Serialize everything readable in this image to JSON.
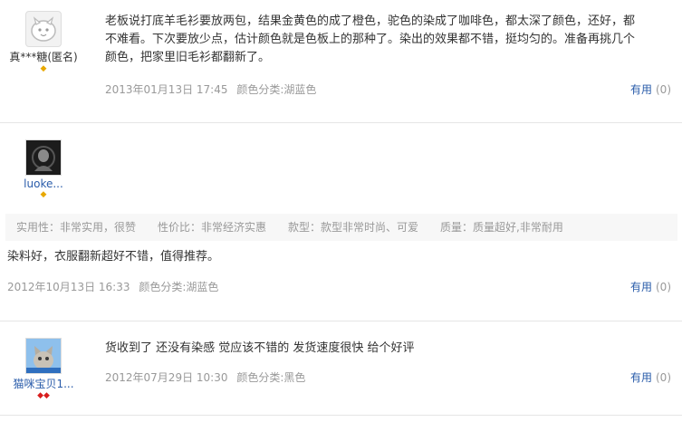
{
  "reviews": [
    {
      "username": "真***糖(匿名)",
      "avatar_icon": "default-face-icon",
      "badge": "◆",
      "content_lines": [
        "老板说打底羊毛衫要放两包，结果金黄色的成了橙色，驼色的染成了咖啡色，都太深了颜色，还好，都",
        "不难看。下次要放少点，估计颜色就是色板上的那种了。染出的效果都不错，挺均匀的。准备再挑几个",
        "颜色，把家里旧毛衫都翻新了。"
      ],
      "date": "2013年01月13日 17:45",
      "color": "颜色分类:湖蓝色",
      "useful_label": "有用",
      "useful_count": "(0)"
    },
    {
      "username": "luoke...",
      "avatar_icon": "dark-portrait-icon",
      "badge": "◆",
      "tags": [
        "实用性：非常实用，很赞",
        "性价比：非常经济实惠",
        "款型：款型非常时尚、可爱",
        "质量：质量超好,非常耐用"
      ],
      "content": "染料好，衣服翻新超好不错，值得推荐。",
      "date": "2012年10月13日 16:33",
      "color": "颜色分类:湖蓝色",
      "useful_label": "有用",
      "useful_count": "(0)"
    },
    {
      "username": "猫咪宝贝1...",
      "avatar_icon": "cat-photo-icon",
      "badge": "◆◆",
      "content": "货收到了 还没有染感 觉应该不错的 发货速度很快 给个好评",
      "date": "2012年07月29日 10:30",
      "color": "颜色分类:黑色",
      "useful_label": "有用",
      "useful_count": "(0)"
    }
  ]
}
